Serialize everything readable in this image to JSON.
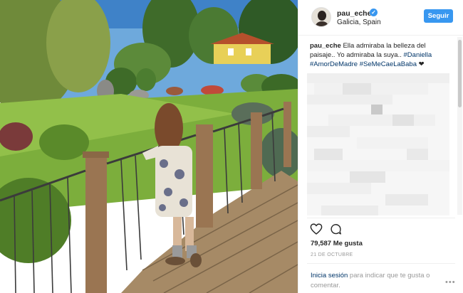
{
  "post": {
    "username": "pau_eche",
    "location": "Galicia, Spain",
    "follow_label": "Seguir",
    "verified_glyph": "✓"
  },
  "caption": {
    "username": "pau_eche",
    "text": " Ella admiraba la belleza del paisaje.. Yo admiraba la suya.. ",
    "hashtags": [
      "#Daniella",
      "#AmorDeMadre",
      "#SeMeCaeLaBaba"
    ],
    "heart": "❤"
  },
  "actions": {
    "likes": "79,587 Me gusta",
    "date": "21 DE OCTUBRE",
    "login_link": "Inicia sesión",
    "login_rest": " para indicar que te gusta o comentar.",
    "more_glyph": "•••"
  },
  "icons": {
    "like": "heart-outline-icon",
    "comment": "speech-bubble-icon",
    "verified": "verified-badge-icon",
    "more": "more-options-icon"
  },
  "colors": {
    "accent": "#3897f0",
    "link": "#003569",
    "muted": "#999999"
  }
}
